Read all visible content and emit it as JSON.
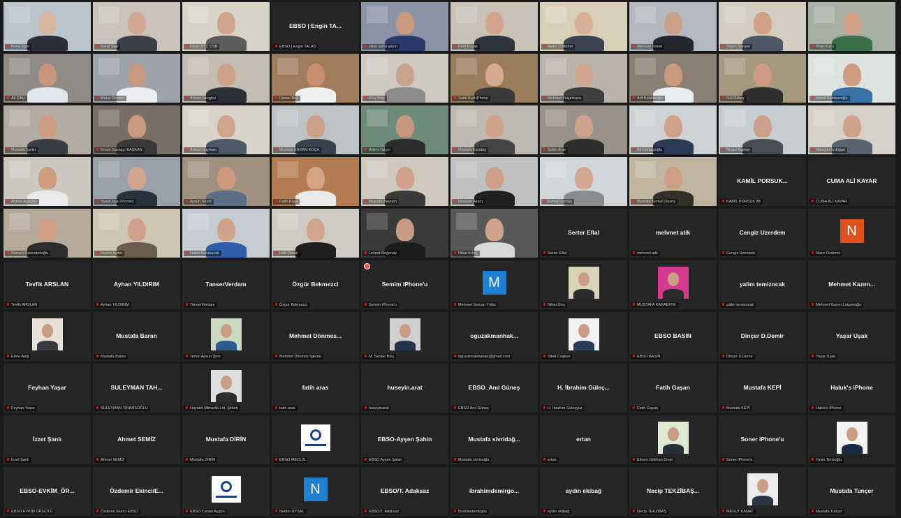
{
  "app": "Zoom gallery view",
  "tiles": [
    {
      "n": "Berat Egin",
      "t": "video",
      "c": [
        "#b9c4cc",
        "#2c2f3a",
        "#d8b6a0"
      ],
      "active": true
    },
    {
      "n": "Berat Şişli",
      "t": "video",
      "c": [
        "#c9c3bb",
        "#3a3f4a",
        "#d2a894"
      ]
    },
    {
      "n": "Elvan BTC OSB",
      "t": "video",
      "c": [
        "#d8d3c7",
        "#5b5b5b",
        "#cfa58e"
      ]
    },
    {
      "n": "EBSO | Engin TALAS",
      "t": "text",
      "big": "EBSO | Engin TA..."
    },
    {
      "n": "ebso şahsi yayın",
      "t": "video",
      "c": [
        "#8b93a6",
        "#2b3a6a",
        "#c99a80"
      ]
    },
    {
      "n": "Ferit Koçak",
      "t": "video",
      "c": [
        "#c7c1b6",
        "#30333b",
        "#d3a58c"
      ]
    },
    {
      "n": "Aydın Özdemir",
      "t": "video",
      "c": [
        "#d9cfb8",
        "#3d4252",
        "#d8b096"
      ]
    },
    {
      "n": "Mehmet Temel",
      "t": "video",
      "c": [
        "#b4b8be",
        "#25272c",
        "#caa088"
      ]
    },
    {
      "n": "Yeşim Sarıyer",
      "t": "video",
      "c": [
        "#d3cdc2",
        "#505766",
        "#cf9f86"
      ]
    },
    {
      "n": "İlhan Kuzu",
      "t": "video",
      "c": [
        "#a8b0a5",
        "#3b6f4a",
        "#d1a286"
      ]
    },
    {
      "n": "Ali Çiftçi",
      "t": "video",
      "c": [
        "#8f8a86",
        "#dfe6ee",
        "#c79579"
      ]
    },
    {
      "n": "Murat Demirci",
      "t": "video",
      "c": [
        "#9ea2aa",
        "#ecedf0",
        "#c89a82"
      ]
    },
    {
      "n": "Ahmet Sevgiler",
      "t": "video",
      "c": [
        "#c4bdb2",
        "#2e3138",
        "#cfa28a"
      ]
    },
    {
      "n": "Hasan Bey",
      "t": "video",
      "c": [
        "#a07c5c",
        "#efefef",
        "#c78d6e"
      ]
    },
    {
      "n": "Kılıç Mac",
      "t": "video",
      "c": [
        "#cfcac0",
        "#8c8c8c",
        "#caa38c"
      ]
    },
    {
      "n": "Sami Kurt iPhone",
      "t": "video",
      "c": [
        "#9b7d5e",
        "#3a3a3a",
        "#d3a98f"
      ]
    },
    {
      "n": "Mehmet Yalçınkaya",
      "t": "video",
      "c": [
        "#b9b3aa",
        "#3f3f3f",
        "#d0a68c"
      ]
    },
    {
      "n": "Arif Kalafatoğlu",
      "t": "video",
      "c": [
        "#8a7f73",
        "#e8ecf0",
        "#c99b80"
      ]
    },
    {
      "n": "Gül Özbey",
      "t": "video",
      "c": [
        "#a5987f",
        "#2f2f2f",
        "#cf9a85"
      ]
    },
    {
      "n": "İsmail Kamburoğlu",
      "t": "video",
      "c": [
        "#dfe3e0",
        "#3b72a8",
        "#cd9b80"
      ]
    },
    {
      "n": "Mustafa Şahin",
      "t": "video",
      "c": [
        "#b3aca2",
        "#3a3d45",
        "#cc9c82"
      ]
    },
    {
      "n": "Erhan Savaşçı BAŞKAN",
      "t": "video",
      "c": [
        "#7a6f66",
        "#3a3a3a",
        "#c99a7e"
      ]
    },
    {
      "n": "Ahmet Sayman",
      "t": "video",
      "c": [
        "#d9d4ca",
        "#4e5a6a",
        "#cfa68c"
      ]
    },
    {
      "n": "Mustafa ERKAN KOÇA",
      "t": "video",
      "c": [
        "#bfc2c4",
        "#38424f",
        "#caa088"
      ]
    },
    {
      "n": "Adem Yalçın",
      "t": "video",
      "c": [
        "#6e8a7a",
        "#2c2c2c",
        "#c7977d"
      ]
    },
    {
      "n": "Mustafa Karataş",
      "t": "video",
      "c": [
        "#bdb8b0",
        "#444",
        "#cfa28a"
      ]
    },
    {
      "n": "Selim Acar",
      "t": "video",
      "c": [
        "#9a938a",
        "#2e2e2e",
        "#d0a48b"
      ]
    },
    {
      "n": "Ali Gürbüzoğlu",
      "t": "video",
      "c": [
        "#cfd2d4",
        "#2d3a55",
        "#cda188"
      ]
    },
    {
      "n": "Niyazi Kaptan",
      "t": "video",
      "c": [
        "#c7cdd1",
        "#4a4f56",
        "#cba08a"
      ]
    },
    {
      "n": "Hüseyin Erdoğan",
      "t": "video",
      "c": [
        "#d6d1c8",
        "#5a6370",
        "#cfa38a"
      ]
    },
    {
      "n": "Ahmet Açıkgöz",
      "t": "video",
      "c": [
        "#cbc7c1",
        "#e9e9e9",
        "#cf9b7f"
      ]
    },
    {
      "n": "Yusuf Ziya Dönmez",
      "t": "video",
      "c": [
        "#9aa0aa",
        "#27333f",
        "#d1a58e"
      ]
    },
    {
      "n": "Aysun Sezer",
      "t": "video",
      "c": [
        "#a19180",
        "#5a6f86",
        "#cd9a7f"
      ]
    },
    {
      "n": "Fatih Kaya",
      "t": "video",
      "c": [
        "#b37c52",
        "#eaeaea",
        "#d4a487"
      ]
    },
    {
      "n": "Mustafa Bayram",
      "t": "video",
      "c": [
        "#cfc9bd",
        "#3b3b3b",
        "#d0a08a"
      ]
    },
    {
      "n": "Hüseyin Aksoy",
      "t": "video",
      "c": [
        "#c0c0c0",
        "#1f1f1f",
        "#cd9f88"
      ]
    },
    {
      "n": "Kemal Duman",
      "t": "video",
      "c": [
        "#d2d6d8",
        "#8a8d90",
        "#d0a892"
      ]
    },
    {
      "n": "Mustafa Kemal Ulusoy",
      "t": "video",
      "c": [
        "#c1b59f",
        "#33302b",
        "#cc9f85"
      ]
    },
    {
      "n": "KAMİL PORSUK 88",
      "t": "text",
      "big": "KAMİL PORSUK..."
    },
    {
      "n": "CUMA ALİ KAYAR",
      "t": "text",
      "big": "CUMA ALİ KAYAR"
    },
    {
      "n": "Osman Darendelioğlu",
      "t": "video",
      "c": [
        "#b7a99a",
        "#2d2d2d",
        "#cf9d84"
      ]
    },
    {
      "n": "Nazım Aydın",
      "t": "video",
      "c": [
        "#cfc6b4",
        "#6c5c4c",
        "#cfa087"
      ]
    },
    {
      "n": "Halim Karabacak",
      "t": "video",
      "c": [
        "#c6ccd2",
        "#2f5fa8",
        "#d0a38a"
      ]
    },
    {
      "n": "Halil Demir",
      "t": "video",
      "c": [
        "#cfcac3",
        "#1f1f1f",
        "#d1a48c"
      ]
    },
    {
      "n": "Levent Doğanay",
      "t": "video",
      "c": [
        "#3a3a3a",
        "#1c1c1c",
        "#c89b84"
      ]
    },
    {
      "n": "Nihat Kılınç",
      "t": "video",
      "c": [
        "#595959",
        "#d9d9d9",
        "#cfa28b"
      ]
    },
    {
      "n": "Serter Eflal",
      "t": "text",
      "big": "Serter Eflal"
    },
    {
      "n": "mehmet atik",
      "t": "text",
      "big": "mehmet atik"
    },
    {
      "n": "Cengiz Uzerdem",
      "t": "text",
      "big": "Cengiz Uzerdem"
    },
    {
      "n": "Nazır Özdemir",
      "t": "avatar",
      "letter": "N",
      "color": "#e0521d"
    },
    {
      "n": "Tevfik ARSLAN",
      "t": "text",
      "big": "Tevfik ARSLAN"
    },
    {
      "n": "Ayhan YILDIRIM",
      "t": "text",
      "big": "Ayhan YILDIRIM"
    },
    {
      "n": "TanserVerdanı",
      "t": "text",
      "big": "TanserVerdanı"
    },
    {
      "n": "Özgür Bekmezci",
      "t": "text",
      "big": "Özgür Bekmezci"
    },
    {
      "n": "Semim iPhone'u",
      "t": "text",
      "big": "Semim iPhone'u",
      "rec": true
    },
    {
      "n": "Mehmet Sercan Yıldız",
      "t": "avatar",
      "letter": "M",
      "color": "#1f7fd1"
    },
    {
      "n": "Nihat Dinç",
      "t": "pic",
      "c": [
        "#d8d2b8",
        "#2a2a2a"
      ]
    },
    {
      "n": "MUSTAFA KARABIYIK",
      "t": "pic",
      "c": [
        "#d43b8f",
        "#2a2a2a"
      ]
    },
    {
      "n": "yalim temizocak",
      "t": "text",
      "big": "yalim temizocak"
    },
    {
      "n": "Mehmet Kazım Lokumoğlu",
      "t": "text",
      "big": "Mehmet Kazım..."
    },
    {
      "n": "Emre Ateş",
      "t": "pic",
      "c": [
        "#e8e2d6",
        "#3a3a3a"
      ]
    },
    {
      "n": "Mustafa Baran",
      "t": "text",
      "big": "Mustafa Baran"
    },
    {
      "n": "Temel Aysun Şirin",
      "t": "pic",
      "c": [
        "#cbd9c3",
        "#2f5b8e"
      ]
    },
    {
      "n": "Mehmet Dönmez İşleme",
      "t": "text",
      "big": "Mehmet Dönmes..."
    },
    {
      "n": "M. Serdar Kılıç",
      "t": "pic",
      "c": [
        "#cfcfcf",
        "#26324a"
      ]
    },
    {
      "n": "oguzakmanhakan@gmail.com",
      "t": "text",
      "big": "oguzakmanhak..."
    },
    {
      "n": "Sibel Coşkun",
      "t": "pic",
      "c": [
        "#f2f2f2",
        "#2d3b57"
      ]
    },
    {
      "n": "EBSO BASIN",
      "t": "text",
      "big": "EBSO BASIN"
    },
    {
      "n": "Dinçer D.Demir",
      "t": "text",
      "big": "Dinçer D.Demir"
    },
    {
      "n": "Yaşar Uşak",
      "t": "text",
      "big": "Yaşar Uşak"
    },
    {
      "n": "Feyhan Yaşar",
      "t": "text",
      "big": "Feyhan Yaşar"
    },
    {
      "n": "SULEYMAN TAHMİSOĞLU",
      "t": "text",
      "big": "SULEYMAN TAH..."
    },
    {
      "n": "Hayalet Mimarlık Ltd. Şirketi",
      "t": "pic",
      "c": [
        "#dedede",
        "#2c2c2c"
      ]
    },
    {
      "n": "fatih aras",
      "t": "text",
      "big": "fatih aras"
    },
    {
      "n": "huseyinarat",
      "t": "text",
      "big": "huseyin.arat"
    },
    {
      "n": "EBSO Anıl Güneş",
      "t": "text",
      "big": "EBSO_Anıl Güneş"
    },
    {
      "n": "H. İbrahim Güleçyüz",
      "t": "text",
      "big": "H. İbrahim Güleç..."
    },
    {
      "n": "Fatih Gaşan",
      "t": "text",
      "big": "Fatih Gaşan"
    },
    {
      "n": "Mustafa KEPİ",
      "t": "text",
      "big": "Mustafa KEPİ"
    },
    {
      "n": "Haluk's iPhone",
      "t": "text",
      "big": "Haluk's iPhone"
    },
    {
      "n": "İzzet Şanlı",
      "t": "text",
      "big": "İzzet Şanlı"
    },
    {
      "n": "Ahmet SEMİZ",
      "t": "text",
      "big": "Ahmet SEMİZ"
    },
    {
      "n": "Mustafa DİRİN",
      "t": "text",
      "big": "Mustafa DİRİN"
    },
    {
      "n": "EBSO MECLİS",
      "t": "logo"
    },
    {
      "n": "EBSO Ayşen Şahin",
      "t": "text",
      "big": "EBSO-Ayşen Şahin"
    },
    {
      "n": "Mustafa sivrisoğlu",
      "t": "text",
      "big": "Mustafa sivridağ..."
    },
    {
      "n": "ertan",
      "t": "text",
      "big": "ertan"
    },
    {
      "n": "Ethem Gökhan Dinar",
      "t": "pic",
      "c": [
        "#dfe8d2",
        "#2b2f3a"
      ]
    },
    {
      "n": "Soner iPhone'u",
      "t": "text",
      "big": "Soner iPhone'u"
    },
    {
      "n": "Yasin Tercioğlu",
      "t": "pic",
      "c": [
        "#f3f3f3",
        "#1c2a4a"
      ]
    },
    {
      "n": "EBSO EVKİM ÖRGÜTÜ",
      "t": "text",
      "big": "EBSO-EVKİM_ÖR..."
    },
    {
      "n": "Özdemir Ekinci EBSO",
      "t": "text",
      "big": "Özdemir Ekinci/E..."
    },
    {
      "n": "EBSO Cenan Aygün",
      "t": "logo"
    },
    {
      "n": "Nedim UYSAL",
      "t": "avatar",
      "letter": "N",
      "color": "#1f7fd1"
    },
    {
      "n": "EBSO/T. Adaksaz",
      "t": "text",
      "big": "EBSO/T. Adaksaz"
    },
    {
      "n": "İbrahimdemirgöz",
      "t": "text",
      "big": "ibrahimdemirgo..."
    },
    {
      "n": "aydın ekibağ",
      "t": "text",
      "big": "aydın ekibağ"
    },
    {
      "n": "Necip TEKZİBAŞ",
      "t": "text",
      "big": "Necip TEKZİBAŞ..."
    },
    {
      "n": "MESUT KANAT",
      "t": "pic",
      "c": [
        "#ebebeb",
        "#2b3442"
      ]
    },
    {
      "n": "Mustafa Tunçer",
      "t": "text",
      "big": "Mustafa Tunçer"
    }
  ]
}
